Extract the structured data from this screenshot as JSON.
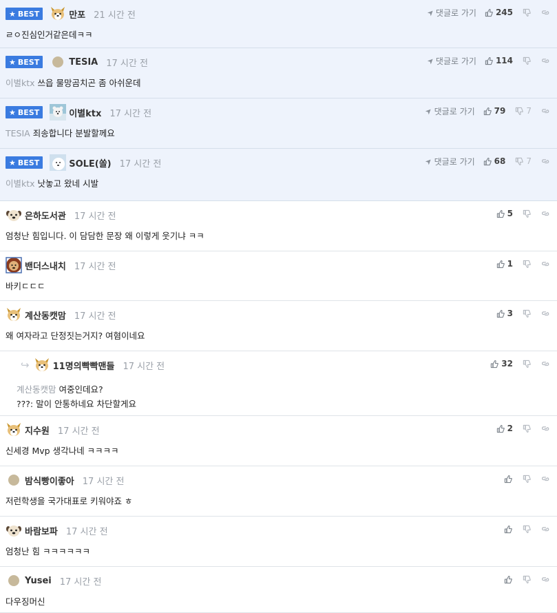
{
  "labels": {
    "best": "BEST",
    "reply_to": "댓글로 가기"
  },
  "comments": [
    {
      "best": true,
      "avatar": "dog-shiba",
      "nick": "만포",
      "time": "21 시간 전",
      "to": "",
      "lines": [
        "ㄹㅇ진심인거같은데ㅋㅋ"
      ],
      "up": "245",
      "down": ""
    },
    {
      "best": true,
      "avatar": "dot",
      "nick": "TESIA",
      "time": "17 시간 전",
      "to": "이별ktx",
      "lines": [
        "쓰읍 물망곰치곤 좀 아쉬운데"
      ],
      "up": "114",
      "down": ""
    },
    {
      "best": true,
      "avatar": "bear-photo",
      "nick": "이별ktx",
      "time": "17 시간 전",
      "to": "TESIA",
      "lines": [
        "죄송합니다 분발할께요"
      ],
      "up": "79",
      "down": "7"
    },
    {
      "best": true,
      "avatar": "white-photo",
      "nick": "SOLE(쏠)",
      "time": "17 시간 전",
      "to": "이별ktx",
      "lines": [
        "낫놓고 왔네 시발"
      ],
      "up": "68",
      "down": "7"
    },
    {
      "best": false,
      "avatar": "dog-pug",
      "nick": "은하도서관",
      "time": "17 시간 전",
      "to": "",
      "lines": [
        "엄청난 힘입니다. 이 담담한 문장 왜 이렇게 웃기냐 ㅋㅋ"
      ],
      "up": "5",
      "down": ""
    },
    {
      "best": false,
      "avatar": "lion",
      "nick": "밴더스내치",
      "time": "17 시간 전",
      "to": "",
      "lines": [
        "바키ㄷㄷㄷ"
      ],
      "up": "1",
      "down": ""
    },
    {
      "best": false,
      "avatar": "dog-shiba",
      "nick": "계산동캣맘",
      "time": "17 시간 전",
      "to": "",
      "lines": [
        "왜 여자라고 단정짓는거지? 여혐이네요"
      ],
      "up": "3",
      "down": ""
    },
    {
      "best": false,
      "reply": true,
      "avatar": "dog-shiba",
      "nick": "11명의빡빡맨들",
      "time": "17 시간 전",
      "to": "계산동캣맘",
      "lines": [
        "여중인데요?",
        "???: 말이 안통하네요 차단할게요"
      ],
      "up": "32",
      "down": ""
    },
    {
      "best": false,
      "avatar": "dog-shiba",
      "nick": "지수원",
      "time": "17 시간 전",
      "to": "",
      "lines": [
        "신세경 Mvp 생각나네 ㅋㅋㅋㅋ"
      ],
      "up": "2",
      "down": ""
    },
    {
      "best": false,
      "avatar": "dot",
      "nick": "밤식빵이좋아",
      "time": "17 시간 전",
      "to": "",
      "lines": [
        "저런학생을 국가대표로 키워야죠 ㅎ"
      ],
      "up": "",
      "down": ""
    },
    {
      "best": false,
      "avatar": "dog-pug",
      "nick": "바람보파",
      "time": "17 시간 전",
      "to": "",
      "lines": [
        "엄청난 힘 ㅋㅋㅋㅋㅋㅋ"
      ],
      "up": "",
      "down": ""
    },
    {
      "best": false,
      "avatar": "dot",
      "nick": "Yusei",
      "time": "17 시간 전",
      "to": "",
      "lines": [
        "다우징머신"
      ],
      "up": "",
      "down": ""
    }
  ]
}
